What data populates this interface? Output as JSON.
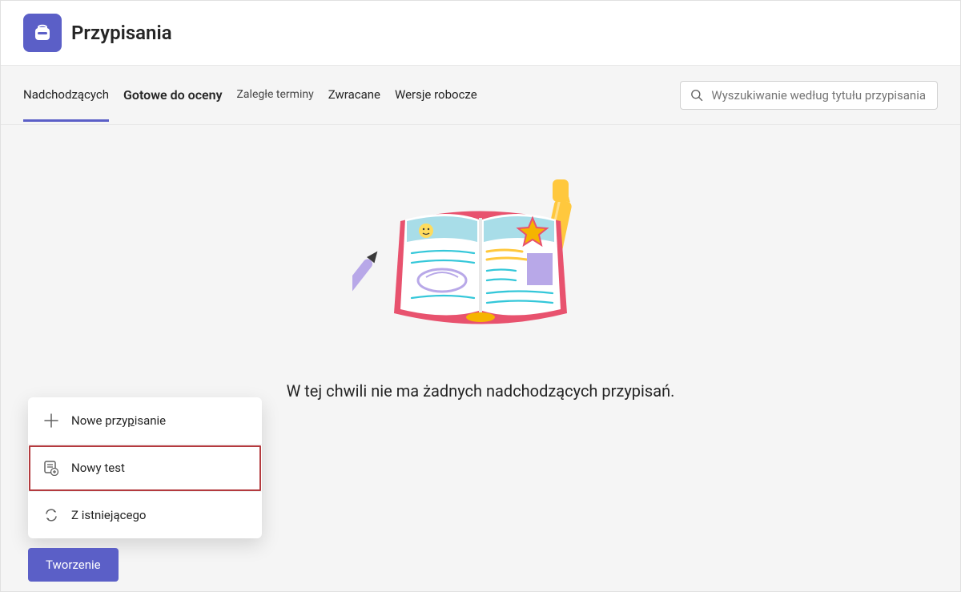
{
  "header": {
    "title": "Przypisania"
  },
  "tabs": {
    "upcoming": "Nadchodzących",
    "ready": "Gotowe do oceny",
    "overdue": "Zaległe terminy",
    "returned": "Zwracane",
    "drafts": "Wersje robocze"
  },
  "search": {
    "placeholder": "Wyszukiwanie według tytułu przypisania"
  },
  "empty": {
    "message": "W tej chwili nie ma żadnych nadchodzących przypisań."
  },
  "menu": {
    "new_assignment_pre": "Nowe przy",
    "new_assignment_u": "p",
    "new_assignment_post": "isanie",
    "new_quiz": "Nowy test",
    "from_existing_pre": "Z istniejące",
    "from_existing_u": "g",
    "from_existing_post": "o"
  },
  "button": {
    "create": "Tworzenie"
  }
}
